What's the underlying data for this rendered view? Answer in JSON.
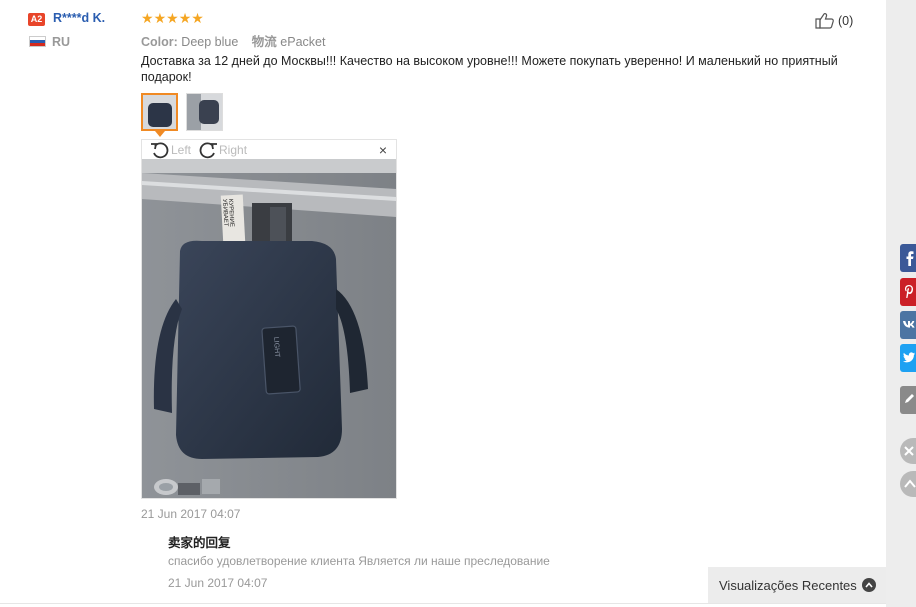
{
  "review": {
    "level_badge": "A2",
    "username": "R****d K.",
    "country": "RU",
    "rating": 5,
    "stars": [
      "★",
      "★",
      "★",
      "★",
      "★"
    ],
    "color_label": "Color:",
    "color_value": "Deep blue",
    "shipping_label": "物流",
    "shipping_value": "ePacket",
    "helpful_count": "(0)",
    "text": "Доставка за 12 дней до Москвы!!! Качество на высоком уровне!!! Можете покупать уверенно! И маленький но приятный подарок!",
    "date": "21 Jun 2017 04:07"
  },
  "viewer": {
    "rotate_left": "Left",
    "rotate_right": "Right",
    "close": "×"
  },
  "seller_reply": {
    "title": "卖家的回复",
    "text": "спасибо удовлетворение клиента Является ли наше преследование",
    "date": "21 Jun 2017 04:07"
  },
  "recent_views": {
    "label": "Visualizações Recentes"
  },
  "share_bar": {
    "colors": {
      "facebook": "#3b5998",
      "pinterest": "#cb2027",
      "vk": "#4c75a3",
      "twitter": "#1da1f2",
      "edit": "#8a8a8a"
    },
    "icons": [
      "facebook-icon",
      "pinterest-icon",
      "vk-icon",
      "twitter-icon",
      "edit-icon",
      "close-icon",
      "up-icon"
    ]
  },
  "colors": {
    "accent_orange": "#f08a24",
    "star": "#f5a623",
    "username": "#2a5db0",
    "badge": "#e8452a"
  }
}
